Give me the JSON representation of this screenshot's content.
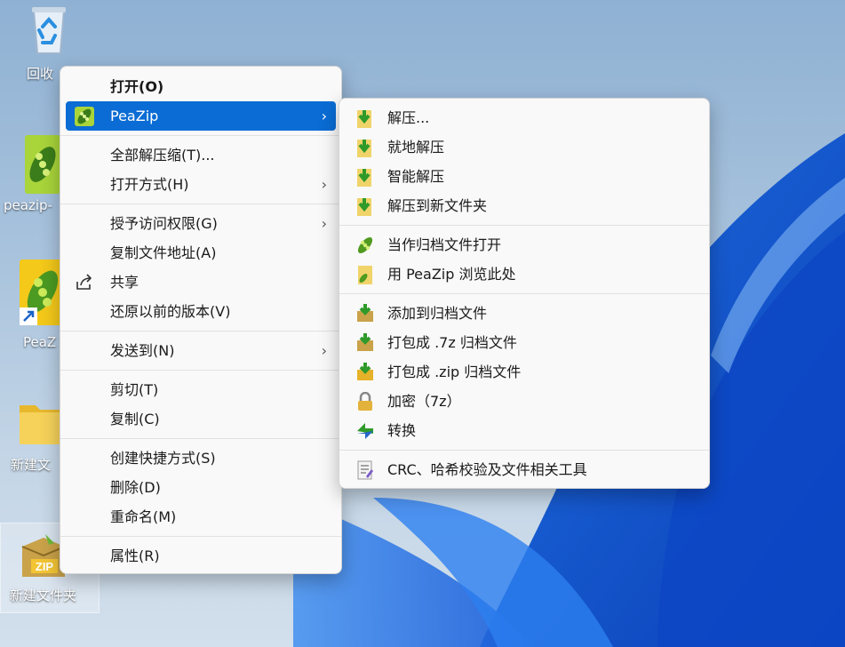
{
  "desktop": {
    "icons": [
      {
        "label": "回收",
        "icon": "recycle-bin-icon"
      },
      {
        "label": "peazip-",
        "icon": "peazip-app-icon"
      },
      {
        "label": "PeaZ",
        "icon": "peazip-shortcut-icon"
      },
      {
        "label": "新建文",
        "icon": "folder-icon"
      },
      {
        "label": "新建文件夹",
        "icon": "zip-archive-icon"
      }
    ]
  },
  "context_menu": {
    "items": [
      {
        "label": "打开(O)"
      },
      {
        "label": "PeaZip",
        "icon": "peazip-icon"
      },
      {
        "label": "全部解压缩(T)..."
      },
      {
        "label": "打开方式(H)"
      },
      {
        "label": "授予访问权限(G)"
      },
      {
        "label": "复制文件地址(A)"
      },
      {
        "label": "共享",
        "icon": "share-icon"
      },
      {
        "label": "还原以前的版本(V)"
      },
      {
        "label": "发送到(N)"
      },
      {
        "label": "剪切(T)"
      },
      {
        "label": "复制(C)"
      },
      {
        "label": "创建快捷方式(S)"
      },
      {
        "label": "删除(D)"
      },
      {
        "label": "重命名(M)"
      },
      {
        "label": "属性(R)"
      }
    ],
    "submenu_arrow": "›"
  },
  "peazip_submenu": {
    "items": [
      {
        "label": "解压...",
        "icon": "extract-icon"
      },
      {
        "label": "就地解压",
        "icon": "extract-here-icon"
      },
      {
        "label": "智能解压",
        "icon": "smart-extract-icon"
      },
      {
        "label": "解压到新文件夹",
        "icon": "extract-folder-icon"
      },
      {
        "label": "当作归档文件打开",
        "icon": "peazip-open-icon"
      },
      {
        "label": "用 PeaZip 浏览此处",
        "icon": "peazip-browse-icon"
      },
      {
        "label": "添加到归档文件",
        "icon": "add-archive-icon"
      },
      {
        "label": "打包成 .7z 归档文件",
        "icon": "pack-7z-icon"
      },
      {
        "label": "打包成 .zip 归档文件",
        "icon": "pack-zip-icon"
      },
      {
        "label": "加密（7z）",
        "icon": "lock-icon"
      },
      {
        "label": "转换",
        "icon": "convert-icon"
      },
      {
        "label": "CRC、哈希校验及文件相关工具",
        "icon": "checksum-icon"
      }
    ]
  },
  "colors": {
    "highlight": "#0a6cd4",
    "menu_bg": "#f9f9f9",
    "peazip_green": "#7cc01e",
    "extract_green": "#3fa534"
  }
}
